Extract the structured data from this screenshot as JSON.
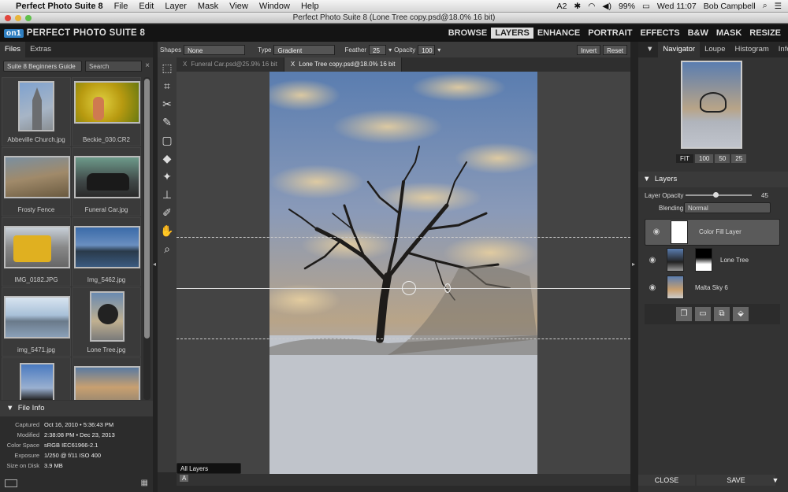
{
  "menubar": {
    "apple": "",
    "app": "Perfect Photo Suite 8",
    "items": [
      "File",
      "Edit",
      "Layer",
      "Mask",
      "View",
      "Window",
      "Help"
    ],
    "status": {
      "adobe": "2",
      "battery": "99%",
      "time": "Wed 11:07",
      "user": "Bob Campbell"
    }
  },
  "window": {
    "title": "Perfect Photo Suite 8 (Lone Tree copy.psd@18.0% 16 bit)"
  },
  "brand": {
    "badge": "on1",
    "name": "PERFECT PHOTO SUITE 8"
  },
  "modes": [
    {
      "label": "BROWSE",
      "active": false
    },
    {
      "label": "LAYERS",
      "active": true
    },
    {
      "label": "ENHANCE",
      "active": false
    },
    {
      "label": "PORTRAIT",
      "active": false
    },
    {
      "label": "EFFECTS",
      "active": false
    },
    {
      "label": "B&W",
      "active": false
    },
    {
      "label": "MASK",
      "active": false
    },
    {
      "label": "RESIZE",
      "active": false
    }
  ],
  "left": {
    "tabs": [
      "Files",
      "Extras"
    ],
    "source_select": "Suite 8 Beginners Guide",
    "search_placeholder": "Search",
    "files": [
      {
        "name": "Abbeville Church.jpg"
      },
      {
        "name": "Beckie_030.CR2"
      },
      {
        "name": "Frosty Fence"
      },
      {
        "name": "Funeral Car.jpg"
      },
      {
        "name": "IMG_0182.JPG"
      },
      {
        "name": "Img_5462.jpg"
      },
      {
        "name": "img_5471.jpg"
      },
      {
        "name": "Lone Tree.jpg"
      },
      {
        "name": ""
      },
      {
        "name": ""
      }
    ],
    "fileinfo": {
      "title": "File Info",
      "rows": [
        {
          "k": "Captured",
          "v": "Oct 16, 2010 • 5:36:43 PM"
        },
        {
          "k": "Modified",
          "v": "2:38:08 PM • Dec 23, 2013"
        },
        {
          "k": "Color Space",
          "v": "sRGB IEC61966-2.1"
        },
        {
          "k": "Exposure",
          "v": "1/250 @ f/11  ISO 400"
        },
        {
          "k": "Size on Disk",
          "v": "3.9 MB"
        }
      ]
    }
  },
  "toolopts": {
    "shapes_label": "Shapes",
    "shapes_value": "None",
    "type_label": "Type",
    "type_value": "Gradient",
    "feather_label": "Feather",
    "feather_value": "25",
    "opacity_label": "Opacity",
    "opacity_value": "100",
    "invert": "Invert",
    "reset": "Reset"
  },
  "doctabs": [
    {
      "label": "Funeral Car.psd@25.9% 16 bit",
      "active": false
    },
    {
      "label": "Lone Tree copy.psd@18.0% 16 bit",
      "active": true
    }
  ],
  "tools": [
    "marquee-icon",
    "crop-icon",
    "transform-icon",
    "brush-icon",
    "frame-icon",
    "eraser-icon",
    "retouch-icon",
    "clone-stamp-icon",
    "refine-brush-icon",
    "hand-icon",
    "zoom-icon"
  ],
  "canvasfoot": {
    "layers_select": "All Layers",
    "a_button": "A"
  },
  "right": {
    "navtabs": [
      "Navigator",
      "Loupe",
      "Histogram",
      "Info"
    ],
    "zoom": [
      {
        "label": "FIT",
        "active": true
      },
      {
        "label": "100",
        "active": false
      },
      {
        "label": "50",
        "active": false
      },
      {
        "label": "25",
        "active": false
      }
    ],
    "layers": {
      "title": "Layers",
      "opacity_label": "Layer Opacity",
      "opacity_value": "45",
      "opacity_fraction": 0.45,
      "blending_label": "Blending",
      "blending_value": "Normal",
      "items": [
        {
          "name": "Color Fill Layer",
          "selected": true
        },
        {
          "name": "Lone Tree",
          "selected": false
        },
        {
          "name": "Malta Sky 6",
          "selected": false
        }
      ]
    },
    "close": "CLOSE",
    "save": "SAVE"
  }
}
